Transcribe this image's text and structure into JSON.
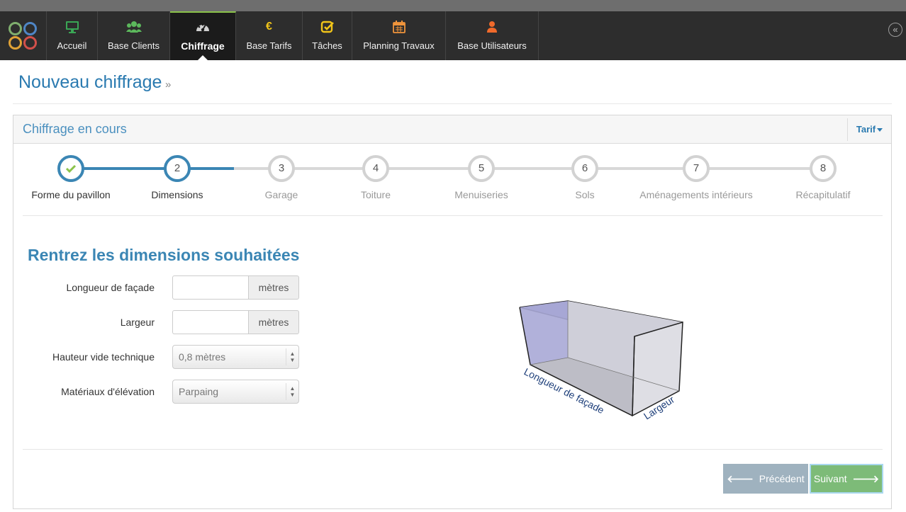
{
  "nav": {
    "items": [
      {
        "label": "Accueil",
        "icon": "monitor-icon",
        "color": "#4caf50"
      },
      {
        "label": "Base Clients",
        "icon": "users-icon",
        "color": "#5cb85c"
      },
      {
        "label": "Chiffrage",
        "icon": "dashboard-icon",
        "color": "#cfcfcf"
      },
      {
        "label": "Base Tarifs",
        "icon": "euro-icon",
        "color": "#f0c419"
      },
      {
        "label": "Tâches",
        "icon": "check-square-icon",
        "color": "#f0c419"
      },
      {
        "label": "Planning Travaux",
        "icon": "calendar-icon",
        "color": "#f0943b"
      },
      {
        "label": "Base Utilisateurs",
        "icon": "user-icon",
        "color": "#f06a2b"
      }
    ],
    "active_index": 2,
    "collapse_icon": "«"
  },
  "page": {
    "title": "Nouveau chiffrage",
    "title_separator": "»"
  },
  "panel": {
    "title": "Chiffrage en cours",
    "tarif_label": "Tarif"
  },
  "steps": [
    {
      "number": "",
      "label": "Forme du pavillon",
      "state": "done"
    },
    {
      "number": "2",
      "label": "Dimensions",
      "state": "current"
    },
    {
      "number": "3",
      "label": "Garage",
      "state": "todo"
    },
    {
      "number": "4",
      "label": "Toiture",
      "state": "todo"
    },
    {
      "number": "5",
      "label": "Menuiseries",
      "state": "todo"
    },
    {
      "number": "6",
      "label": "Sols",
      "state": "todo"
    },
    {
      "number": "7",
      "label": "Aménagements intérieurs",
      "state": "todo"
    },
    {
      "number": "8",
      "label": "Récapitulatif",
      "state": "todo"
    }
  ],
  "form": {
    "title": "Rentrez les dimensions souhaitées",
    "longueur": {
      "label": "Longueur de façade",
      "value": "",
      "unit": "mètres"
    },
    "largeur": {
      "label": "Largeur",
      "value": "",
      "unit": "mètres"
    },
    "hauteur": {
      "label": "Hauteur vide technique",
      "selected": "0,8 mètres"
    },
    "materiaux": {
      "label": "Matériaux d'élévation",
      "selected": "Parpaing"
    }
  },
  "diagram": {
    "longueur_label": "Longueur de façade",
    "largeur_label": "Largeur"
  },
  "buttons": {
    "prev": "Précédent",
    "next": "Suivant"
  },
  "colors": {
    "accent": "#3b86b4",
    "step_done": "#8bc34a",
    "next_button": "#7dbb78",
    "prev_button": "#9fb2bf"
  }
}
